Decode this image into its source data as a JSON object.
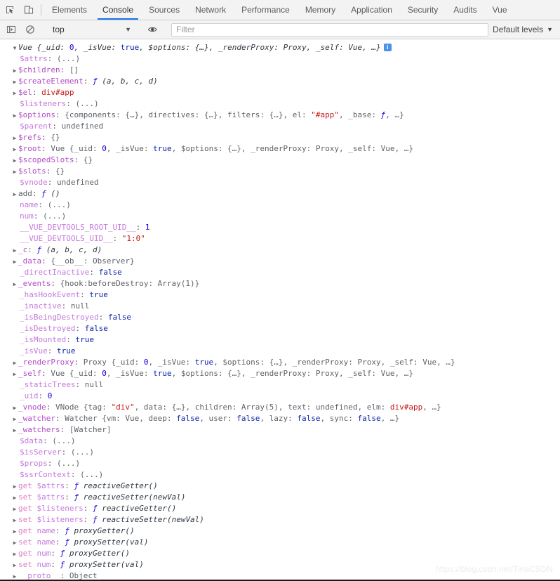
{
  "toolbar": {
    "inspect_icon": "inspect-element-icon",
    "device_icon": "device-toolbar-icon",
    "tabs": [
      {
        "label": "Elements",
        "selected": false
      },
      {
        "label": "Console",
        "selected": true
      },
      {
        "label": "Sources",
        "selected": false
      },
      {
        "label": "Network",
        "selected": false
      },
      {
        "label": "Performance",
        "selected": false
      },
      {
        "label": "Memory",
        "selected": false
      },
      {
        "label": "Application",
        "selected": false
      },
      {
        "label": "Security",
        "selected": false
      },
      {
        "label": "Audits",
        "selected": false
      },
      {
        "label": "Vue",
        "selected": false
      }
    ]
  },
  "filterbar": {
    "sidebar_icon": "console-sidebar-icon",
    "clear_icon": "clear-console-icon",
    "context": "top",
    "context_caret": "▼",
    "eye_icon": "live-expression-eye-icon",
    "filter_placeholder": "Filter",
    "filter_value": "",
    "levels_label": "Default levels",
    "levels_caret": "▼"
  },
  "watermark": "https://blog.csdn.net/TinaCSDN",
  "console_rows": [
    {
      "arrow": "▼",
      "indent": 0,
      "parts": [
        {
          "t": "Vue ",
          "c": "vueh"
        },
        {
          "t": "{",
          "c": "vuehv"
        },
        {
          "t": "_uid",
          "c": "vuehv"
        },
        {
          "t": ": ",
          "c": "vuehv"
        },
        {
          "t": "0",
          "c": "num"
        },
        {
          "t": ", ",
          "c": "vuehv"
        },
        {
          "t": "_isVue",
          "c": "vuehv"
        },
        {
          "t": ": ",
          "c": "vuehv"
        },
        {
          "t": "true",
          "c": "bool"
        },
        {
          "t": ", ",
          "c": "vuehv"
        },
        {
          "t": "$options",
          "c": "vuehv"
        },
        {
          "t": ": {…}, ",
          "c": "vuehv"
        },
        {
          "t": "_renderProxy",
          "c": "vuehv"
        },
        {
          "t": ": Proxy, ",
          "c": "vuehv"
        },
        {
          "t": "_self",
          "c": "vuehv"
        },
        {
          "t": ": Vue, …}",
          "c": "vuehv"
        }
      ],
      "badge": "i"
    },
    {
      "arrow": "",
      "indent": 1,
      "parts": [
        {
          "t": "$attrs",
          "c": "prop"
        },
        {
          "t": ": ",
          "c": "key"
        },
        {
          "t": "(...)",
          "c": "key"
        }
      ]
    },
    {
      "arrow": "▶",
      "indent": 0,
      "parts": [
        {
          "t": "$children",
          "c": "prop-d"
        },
        {
          "t": ": ",
          "c": "key"
        },
        {
          "t": "[]",
          "c": "key"
        }
      ]
    },
    {
      "arrow": "▶",
      "indent": 0,
      "parts": [
        {
          "t": "$createElement",
          "c": "prop-d"
        },
        {
          "t": ": ",
          "c": "key"
        },
        {
          "t": "ƒ",
          "c": "fn"
        },
        {
          "t": " (a, b, c, d)",
          "c": "fnargs"
        }
      ]
    },
    {
      "arrow": "▶",
      "indent": 0,
      "parts": [
        {
          "t": "$el",
          "c": "prop-d"
        },
        {
          "t": ": ",
          "c": "key"
        },
        {
          "t": "div#app",
          "c": "str"
        }
      ]
    },
    {
      "arrow": "",
      "indent": 1,
      "parts": [
        {
          "t": "$listeners",
          "c": "prop"
        },
        {
          "t": ": ",
          "c": "key"
        },
        {
          "t": "(...)",
          "c": "key"
        }
      ]
    },
    {
      "arrow": "▶",
      "indent": 0,
      "parts": [
        {
          "t": "$options",
          "c": "prop-d"
        },
        {
          "t": ": ",
          "c": "key"
        },
        {
          "t": "{components: {…}, directives: {…}, filters: {…}, el: ",
          "c": "cls"
        },
        {
          "t": "\"#app\"",
          "c": "str"
        },
        {
          "t": ", _base: ",
          "c": "cls"
        },
        {
          "t": "ƒ",
          "c": "fn"
        },
        {
          "t": ", …}",
          "c": "cls"
        }
      ]
    },
    {
      "arrow": "",
      "indent": 1,
      "parts": [
        {
          "t": "$parent",
          "c": "prop"
        },
        {
          "t": ": ",
          "c": "key"
        },
        {
          "t": "undefined",
          "c": "undef"
        }
      ]
    },
    {
      "arrow": "▶",
      "indent": 0,
      "parts": [
        {
          "t": "$refs",
          "c": "prop-d"
        },
        {
          "t": ": ",
          "c": "key"
        },
        {
          "t": "{}",
          "c": "key"
        }
      ]
    },
    {
      "arrow": "▶",
      "indent": 0,
      "parts": [
        {
          "t": "$root",
          "c": "prop-d"
        },
        {
          "t": ": ",
          "c": "key"
        },
        {
          "t": "Vue {_uid: ",
          "c": "cls"
        },
        {
          "t": "0",
          "c": "num"
        },
        {
          "t": ", _isVue: ",
          "c": "cls"
        },
        {
          "t": "true",
          "c": "bool"
        },
        {
          "t": ", $options: {…}, _renderProxy: Proxy, _self: Vue, …}",
          "c": "cls"
        }
      ]
    },
    {
      "arrow": "▶",
      "indent": 0,
      "parts": [
        {
          "t": "$scopedSlots",
          "c": "prop-d"
        },
        {
          "t": ": ",
          "c": "key"
        },
        {
          "t": "{}",
          "c": "key"
        }
      ]
    },
    {
      "arrow": "▶",
      "indent": 0,
      "parts": [
        {
          "t": "$slots",
          "c": "prop-d"
        },
        {
          "t": ": ",
          "c": "key"
        },
        {
          "t": "{}",
          "c": "key"
        }
      ]
    },
    {
      "arrow": "",
      "indent": 1,
      "parts": [
        {
          "t": "$vnode",
          "c": "prop"
        },
        {
          "t": ": ",
          "c": "key"
        },
        {
          "t": "undefined",
          "c": "undef"
        }
      ]
    },
    {
      "arrow": "▶",
      "indent": 0,
      "parts": [
        {
          "t": "add",
          "c": "key"
        },
        {
          "t": ": ",
          "c": "key"
        },
        {
          "t": "ƒ",
          "c": "fn"
        },
        {
          "t": " ()",
          "c": "fnargs"
        }
      ]
    },
    {
      "arrow": "",
      "indent": 1,
      "parts": [
        {
          "t": "name",
          "c": "prop"
        },
        {
          "t": ": ",
          "c": "key"
        },
        {
          "t": "(...)",
          "c": "key"
        }
      ]
    },
    {
      "arrow": "",
      "indent": 1,
      "parts": [
        {
          "t": "num",
          "c": "prop"
        },
        {
          "t": ": ",
          "c": "key"
        },
        {
          "t": "(...)",
          "c": "key"
        }
      ]
    },
    {
      "arrow": "",
      "indent": 1,
      "parts": [
        {
          "t": "__VUE_DEVTOOLS_ROOT_UID__",
          "c": "prop"
        },
        {
          "t": ": ",
          "c": "key"
        },
        {
          "t": "1",
          "c": "num"
        }
      ]
    },
    {
      "arrow": "",
      "indent": 1,
      "parts": [
        {
          "t": "__VUE_DEVTOOLS_UID__",
          "c": "prop"
        },
        {
          "t": ": ",
          "c": "key"
        },
        {
          "t": "\"1:0\"",
          "c": "str"
        }
      ]
    },
    {
      "arrow": "▶",
      "indent": 0,
      "parts": [
        {
          "t": "_c",
          "c": "prop-d"
        },
        {
          "t": ": ",
          "c": "key"
        },
        {
          "t": "ƒ",
          "c": "fn"
        },
        {
          "t": " (a, b, c, d)",
          "c": "fnargs"
        }
      ]
    },
    {
      "arrow": "▶",
      "indent": 0,
      "parts": [
        {
          "t": "_data",
          "c": "prop-d"
        },
        {
          "t": ": ",
          "c": "key"
        },
        {
          "t": "{__ob__: Observer}",
          "c": "cls"
        }
      ]
    },
    {
      "arrow": "",
      "indent": 1,
      "parts": [
        {
          "t": "_directInactive",
          "c": "prop"
        },
        {
          "t": ": ",
          "c": "key"
        },
        {
          "t": "false",
          "c": "bool"
        }
      ]
    },
    {
      "arrow": "▶",
      "indent": 0,
      "parts": [
        {
          "t": "_events",
          "c": "prop-d"
        },
        {
          "t": ": ",
          "c": "key"
        },
        {
          "t": "{hook:beforeDestroy: Array(1)}",
          "c": "cls"
        }
      ]
    },
    {
      "arrow": "",
      "indent": 1,
      "parts": [
        {
          "t": "_hasHookEvent",
          "c": "prop"
        },
        {
          "t": ": ",
          "c": "key"
        },
        {
          "t": "true",
          "c": "bool"
        }
      ]
    },
    {
      "arrow": "",
      "indent": 1,
      "parts": [
        {
          "t": "_inactive",
          "c": "prop"
        },
        {
          "t": ": ",
          "c": "key"
        },
        {
          "t": "null",
          "c": "nul"
        }
      ]
    },
    {
      "arrow": "",
      "indent": 1,
      "parts": [
        {
          "t": "_isBeingDestroyed",
          "c": "prop"
        },
        {
          "t": ": ",
          "c": "key"
        },
        {
          "t": "false",
          "c": "bool"
        }
      ]
    },
    {
      "arrow": "",
      "indent": 1,
      "parts": [
        {
          "t": "_isDestroyed",
          "c": "prop"
        },
        {
          "t": ": ",
          "c": "key"
        },
        {
          "t": "false",
          "c": "bool"
        }
      ]
    },
    {
      "arrow": "",
      "indent": 1,
      "parts": [
        {
          "t": "_isMounted",
          "c": "prop"
        },
        {
          "t": ": ",
          "c": "key"
        },
        {
          "t": "true",
          "c": "bool"
        }
      ]
    },
    {
      "arrow": "",
      "indent": 1,
      "parts": [
        {
          "t": "_isVue",
          "c": "prop"
        },
        {
          "t": ": ",
          "c": "key"
        },
        {
          "t": "true",
          "c": "bool"
        }
      ]
    },
    {
      "arrow": "▶",
      "indent": 0,
      "parts": [
        {
          "t": "_renderProxy",
          "c": "prop-d"
        },
        {
          "t": ": ",
          "c": "key"
        },
        {
          "t": "Proxy {_uid: ",
          "c": "cls"
        },
        {
          "t": "0",
          "c": "num"
        },
        {
          "t": ", _isVue: ",
          "c": "cls"
        },
        {
          "t": "true",
          "c": "bool"
        },
        {
          "t": ", $options: {…}, _renderProxy: Proxy, _self: Vue, …}",
          "c": "cls"
        }
      ]
    },
    {
      "arrow": "▶",
      "indent": 0,
      "parts": [
        {
          "t": "_self",
          "c": "prop-d"
        },
        {
          "t": ": ",
          "c": "key"
        },
        {
          "t": "Vue {_uid: ",
          "c": "cls"
        },
        {
          "t": "0",
          "c": "num"
        },
        {
          "t": ", _isVue: ",
          "c": "cls"
        },
        {
          "t": "true",
          "c": "bool"
        },
        {
          "t": ", $options: {…}, _renderProxy: Proxy, _self: Vue, …}",
          "c": "cls"
        }
      ]
    },
    {
      "arrow": "",
      "indent": 1,
      "parts": [
        {
          "t": "_staticTrees",
          "c": "prop"
        },
        {
          "t": ": ",
          "c": "key"
        },
        {
          "t": "null",
          "c": "nul"
        }
      ]
    },
    {
      "arrow": "",
      "indent": 1,
      "parts": [
        {
          "t": "_uid",
          "c": "prop"
        },
        {
          "t": ": ",
          "c": "key"
        },
        {
          "t": "0",
          "c": "num"
        }
      ]
    },
    {
      "arrow": "▶",
      "indent": 0,
      "parts": [
        {
          "t": "_vnode",
          "c": "prop-d"
        },
        {
          "t": ": ",
          "c": "key"
        },
        {
          "t": "VNode {tag: ",
          "c": "cls"
        },
        {
          "t": "\"div\"",
          "c": "str"
        },
        {
          "t": ", data: {…}, children: Array(5), text: undefined, elm: ",
          "c": "cls"
        },
        {
          "t": "div#app",
          "c": "str"
        },
        {
          "t": ", …}",
          "c": "cls"
        }
      ]
    },
    {
      "arrow": "▶",
      "indent": 0,
      "parts": [
        {
          "t": "_watcher",
          "c": "prop-d"
        },
        {
          "t": ": ",
          "c": "key"
        },
        {
          "t": "Watcher {vm: Vue, deep: ",
          "c": "cls"
        },
        {
          "t": "false",
          "c": "bool"
        },
        {
          "t": ", user: ",
          "c": "cls"
        },
        {
          "t": "false",
          "c": "bool"
        },
        {
          "t": ", lazy: ",
          "c": "cls"
        },
        {
          "t": "false",
          "c": "bool"
        },
        {
          "t": ", sync: ",
          "c": "cls"
        },
        {
          "t": "false",
          "c": "bool"
        },
        {
          "t": ", …}",
          "c": "cls"
        }
      ]
    },
    {
      "arrow": "▶",
      "indent": 0,
      "parts": [
        {
          "t": "_watchers",
          "c": "prop-d"
        },
        {
          "t": ": ",
          "c": "key"
        },
        {
          "t": "[Watcher]",
          "c": "cls"
        }
      ]
    },
    {
      "arrow": "",
      "indent": 1,
      "parts": [
        {
          "t": "$data",
          "c": "prop"
        },
        {
          "t": ": ",
          "c": "key"
        },
        {
          "t": "(...)",
          "c": "key"
        }
      ]
    },
    {
      "arrow": "",
      "indent": 1,
      "parts": [
        {
          "t": "$isServer",
          "c": "prop"
        },
        {
          "t": ": ",
          "c": "key"
        },
        {
          "t": "(...)",
          "c": "key"
        }
      ]
    },
    {
      "arrow": "",
      "indent": 1,
      "parts": [
        {
          "t": "$props",
          "c": "prop"
        },
        {
          "t": ": ",
          "c": "key"
        },
        {
          "t": "(...)",
          "c": "key"
        }
      ]
    },
    {
      "arrow": "",
      "indent": 1,
      "parts": [
        {
          "t": "$ssrContext",
          "c": "prop"
        },
        {
          "t": ": ",
          "c": "key"
        },
        {
          "t": "(...)",
          "c": "key"
        }
      ]
    },
    {
      "arrow": "▶",
      "indent": 0,
      "parts": [
        {
          "t": "get ",
          "c": "getset"
        },
        {
          "t": "$attrs",
          "c": "prop"
        },
        {
          "t": ": ",
          "c": "key"
        },
        {
          "t": "ƒ",
          "c": "fn"
        },
        {
          "t": " reactiveGetter()",
          "c": "fnargs"
        }
      ]
    },
    {
      "arrow": "▶",
      "indent": 0,
      "parts": [
        {
          "t": "set ",
          "c": "getset"
        },
        {
          "t": "$attrs",
          "c": "prop"
        },
        {
          "t": ": ",
          "c": "key"
        },
        {
          "t": "ƒ",
          "c": "fn"
        },
        {
          "t": " reactiveSetter(newVal)",
          "c": "fnargs"
        }
      ]
    },
    {
      "arrow": "▶",
      "indent": 0,
      "parts": [
        {
          "t": "get ",
          "c": "getset"
        },
        {
          "t": "$listeners",
          "c": "prop"
        },
        {
          "t": ": ",
          "c": "key"
        },
        {
          "t": "ƒ",
          "c": "fn"
        },
        {
          "t": " reactiveGetter()",
          "c": "fnargs"
        }
      ]
    },
    {
      "arrow": "▶",
      "indent": 0,
      "parts": [
        {
          "t": "set ",
          "c": "getset"
        },
        {
          "t": "$listeners",
          "c": "prop"
        },
        {
          "t": ": ",
          "c": "key"
        },
        {
          "t": "ƒ",
          "c": "fn"
        },
        {
          "t": " reactiveSetter(newVal)",
          "c": "fnargs"
        }
      ]
    },
    {
      "arrow": "▶",
      "indent": 0,
      "parts": [
        {
          "t": "get ",
          "c": "getset"
        },
        {
          "t": "name",
          "c": "prop"
        },
        {
          "t": ": ",
          "c": "key"
        },
        {
          "t": "ƒ",
          "c": "fn"
        },
        {
          "t": " proxyGetter()",
          "c": "fnargs"
        }
      ]
    },
    {
      "arrow": "▶",
      "indent": 0,
      "parts": [
        {
          "t": "set ",
          "c": "getset"
        },
        {
          "t": "name",
          "c": "prop"
        },
        {
          "t": ": ",
          "c": "key"
        },
        {
          "t": "ƒ",
          "c": "fn"
        },
        {
          "t": " proxySetter(val)",
          "c": "fnargs"
        }
      ]
    },
    {
      "arrow": "▶",
      "indent": 0,
      "parts": [
        {
          "t": "get ",
          "c": "getset"
        },
        {
          "t": "num",
          "c": "prop"
        },
        {
          "t": ": ",
          "c": "key"
        },
        {
          "t": "ƒ",
          "c": "fn"
        },
        {
          "t": " proxyGetter()",
          "c": "fnargs"
        }
      ]
    },
    {
      "arrow": "▶",
      "indent": 0,
      "parts": [
        {
          "t": "set ",
          "c": "getset"
        },
        {
          "t": "num",
          "c": "prop"
        },
        {
          "t": ": ",
          "c": "key"
        },
        {
          "t": "ƒ",
          "c": "fn"
        },
        {
          "t": " proxySetter(val)",
          "c": "fnargs"
        }
      ]
    },
    {
      "arrow": "▶",
      "indent": 0,
      "parts": [
        {
          "t": "__proto__",
          "c": "proto"
        },
        {
          "t": ": ",
          "c": "key"
        },
        {
          "t": "Object",
          "c": "cls"
        }
      ]
    }
  ]
}
